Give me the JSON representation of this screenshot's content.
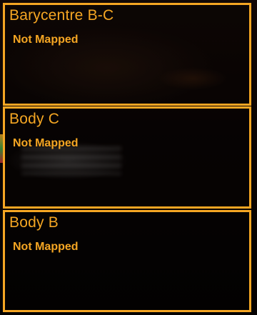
{
  "bodies": [
    {
      "name": "Barycentre B-C",
      "status": "Not Mapped"
    },
    {
      "name": "Body C",
      "status": "Not Mapped"
    },
    {
      "name": "Body B",
      "status": "Not Mapped"
    }
  ],
  "colors": {
    "accent": "#f5a623",
    "background": "#050302"
  }
}
